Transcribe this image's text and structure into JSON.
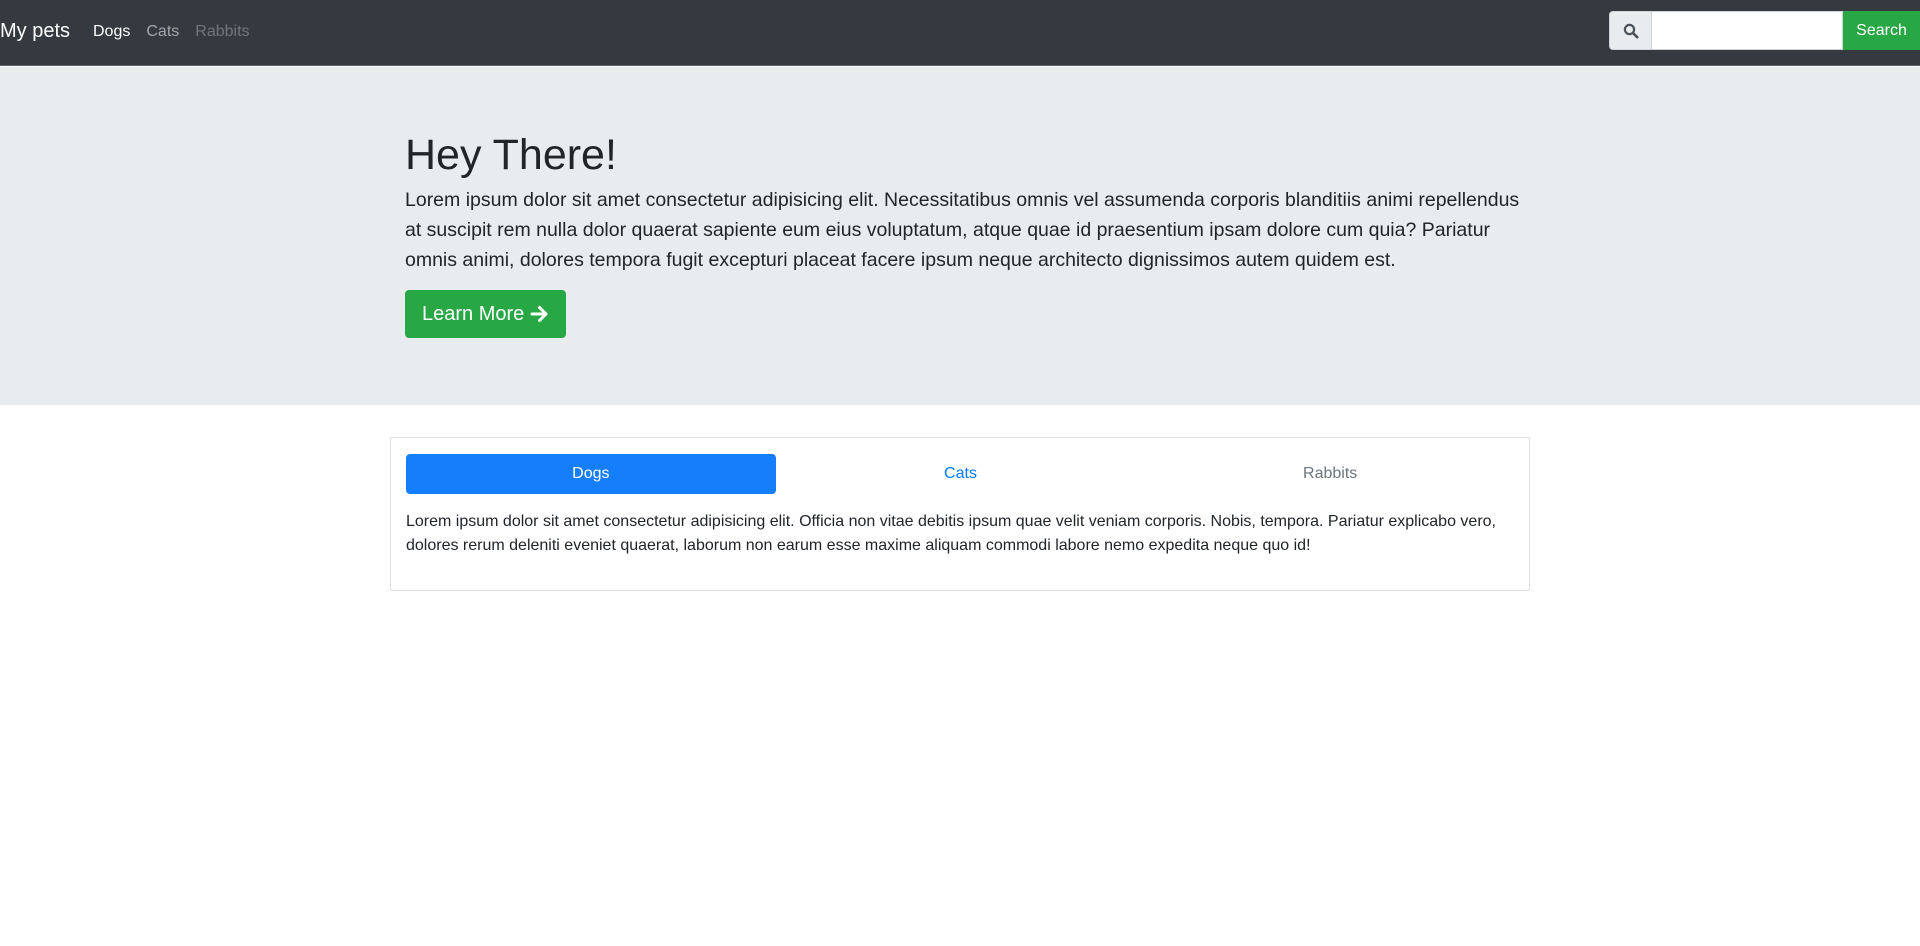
{
  "navbar": {
    "brand": "My pets",
    "links": [
      {
        "label": "Dogs",
        "state": "active"
      },
      {
        "label": "Cats",
        "state": "normal"
      },
      {
        "label": "Rabbits",
        "state": "disabled"
      }
    ],
    "search": {
      "icon": "search-icon",
      "value": "",
      "button_label": "Search"
    }
  },
  "hero": {
    "title": "Hey There!",
    "lead": "Lorem ipsum dolor sit amet consectetur adipisicing elit. Necessitatibus omnis vel assumenda corporis blanditiis animi repellendus at suscipit rem nulla dolor quaerat sapiente eum eius voluptatum, atque quae id praesentium ipsam dolore cum quia? Pariatur omnis animi, dolores tempora fugit excepturi placeat facere ipsum neque architecto dignissimos autem quidem est.",
    "button_label": "Learn More",
    "button_icon": "arrow-right-icon"
  },
  "tabs": {
    "items": [
      {
        "label": "Dogs",
        "state": "active"
      },
      {
        "label": "Cats",
        "state": "link"
      },
      {
        "label": "Rabbits",
        "state": "muted"
      }
    ],
    "content": "Lorem ipsum dolor sit amet consectetur adipisicing elit. Officia non vitae debitis ipsum quae velit veniam corporis. Nobis, tempora. Pariatur explicabo vero, dolores rerum deleniti eveniet quaerat, laborum non earum esse maxime aliquam commodi labore nemo expedita neque quo id!"
  },
  "colors": {
    "navbar_bg": "#343a40",
    "hero_bg": "#e9ecef",
    "success": "#28a745",
    "primary_pill": "#147efb",
    "link": "#007bff"
  }
}
